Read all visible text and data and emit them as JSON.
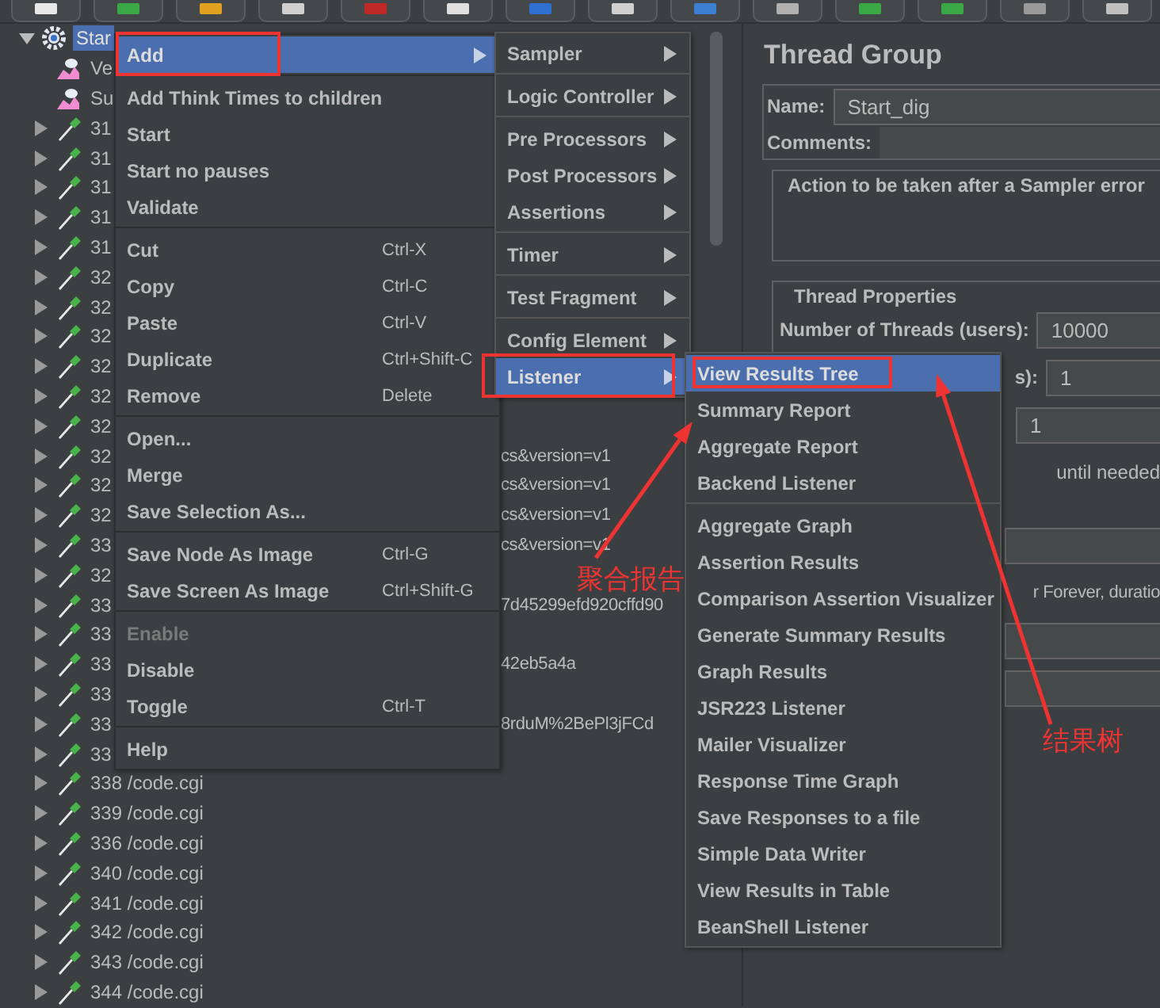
{
  "tree": {
    "items": [
      {
        "label": "Star",
        "kind": "thread_group",
        "expanded": true,
        "selected": true,
        "children": [
          {
            "label": "Ve",
            "kind": "listener",
            "selected": false
          },
          {
            "label": "Su",
            "kind": "listener",
            "selected": false
          },
          {
            "label": "31",
            "kind": "sampler",
            "expanded": false,
            "selected": false
          },
          {
            "label": "31",
            "kind": "sampler",
            "expanded": false,
            "selected": false
          },
          {
            "label": "31",
            "kind": "sampler",
            "expanded": false,
            "selected": false
          },
          {
            "label": "31",
            "kind": "sampler",
            "expanded": false,
            "selected": false
          },
          {
            "label": "31",
            "kind": "sampler",
            "expanded": false,
            "selected": false
          },
          {
            "label": "32",
            "kind": "sampler",
            "expanded": false,
            "selected": false
          },
          {
            "label": "32",
            "kind": "sampler",
            "expanded": false,
            "selected": false
          },
          {
            "label": "32",
            "kind": "sampler",
            "expanded": false,
            "selected": false
          },
          {
            "label": "32",
            "kind": "sampler",
            "expanded": false,
            "selected": false
          },
          {
            "label": "32",
            "kind": "sampler",
            "expanded": false,
            "selected": false
          },
          {
            "label": "32",
            "kind": "sampler",
            "expanded": false,
            "selected": false
          },
          {
            "label": "32",
            "tail": "cs&version=v1",
            "kind": "sampler",
            "expanded": false,
            "selected": false
          },
          {
            "label": "32",
            "tail": "cs&version=v1",
            "kind": "sampler",
            "expanded": false,
            "selected": false
          },
          {
            "label": "32",
            "tail": "cs&version=v1",
            "kind": "sampler",
            "expanded": false,
            "selected": false
          },
          {
            "label": "33",
            "tail": "cs&version=v1",
            "kind": "sampler",
            "expanded": false,
            "selected": false
          },
          {
            "label": "32",
            "kind": "sampler",
            "expanded": false,
            "selected": false
          },
          {
            "label": "33",
            "tail": "7d45299efd920cffd90",
            "kind": "sampler",
            "expanded": false,
            "selected": false
          },
          {
            "label": "33",
            "kind": "sampler",
            "expanded": false,
            "selected": false
          },
          {
            "label": "33",
            "tail": "42eb5a4a",
            "kind": "sampler",
            "expanded": false,
            "selected": false
          },
          {
            "label": "33",
            "kind": "sampler",
            "expanded": false,
            "selected": false
          },
          {
            "label": "33",
            "tail": "8rduM%2BePl3jFCd",
            "kind": "sampler",
            "expanded": false,
            "selected": false
          },
          {
            "label": "33",
            "kind": "sampler",
            "expanded": false,
            "selected": false
          },
          {
            "label": "338 /code.cgi",
            "kind": "sampler",
            "expanded": false,
            "selected": false
          },
          {
            "label": "339 /code.cgi",
            "kind": "sampler",
            "expanded": false,
            "selected": false
          },
          {
            "label": "336 /code.cgi",
            "kind": "sampler",
            "expanded": false,
            "selected": false
          },
          {
            "label": "340 /code.cgi",
            "kind": "sampler",
            "expanded": false,
            "selected": false
          },
          {
            "label": "341 /code.cgi",
            "kind": "sampler",
            "expanded": false,
            "selected": false
          },
          {
            "label": "342 /code.cgi",
            "kind": "sampler",
            "expanded": false,
            "selected": false
          },
          {
            "label": "343 /code.cgi",
            "kind": "sampler",
            "expanded": false,
            "selected": false
          },
          {
            "label": "344 /code.cgi",
            "kind": "sampler",
            "expanded": false,
            "selected": false
          }
        ]
      }
    ]
  },
  "form": {
    "title": "Thread Group",
    "name_label": "Name:",
    "name_value": "Start_dig",
    "comments_label": "Comments:",
    "error_group": "Action to be taken after a Sampler error",
    "thread_properties": {
      "legend": "Thread Properties",
      "rows": [
        {
          "kind": "field",
          "label": "Number of Threads (users):",
          "value": "10000"
        },
        {
          "kind": "field",
          "label": "s):",
          "value": "1"
        },
        {
          "kind": "field",
          "value": "1"
        },
        {
          "kind": "text",
          "label": "until needed"
        },
        {
          "kind": "field"
        },
        {
          "kind": "text",
          "label": "r Forever, duratio"
        },
        {
          "kind": "field"
        },
        {
          "kind": "field"
        }
      ]
    }
  },
  "context_menu": {
    "groups": [
      {
        "items": [
          {
            "label": "Add",
            "submenu": true,
            "selected": true,
            "disabled": false,
            "marked": true
          }
        ]
      },
      {
        "items": [
          {
            "label": "Add Think Times to children",
            "selected": false,
            "disabled": false,
            "marked": false
          },
          {
            "label": "Start",
            "selected": false,
            "disabled": false,
            "marked": false
          },
          {
            "label": "Start no pauses",
            "selected": false,
            "disabled": false,
            "marked": false
          },
          {
            "label": "Validate",
            "selected": false,
            "disabled": false,
            "marked": false
          }
        ]
      },
      {
        "items": [
          {
            "label": "Cut",
            "shortcut": "Ctrl-X",
            "selected": false,
            "disabled": false,
            "marked": false
          },
          {
            "label": "Copy",
            "shortcut": "Ctrl-C",
            "selected": false,
            "disabled": false,
            "marked": false
          },
          {
            "label": "Paste",
            "shortcut": "Ctrl-V",
            "selected": false,
            "disabled": false,
            "marked": false
          },
          {
            "label": "Duplicate",
            "shortcut": "Ctrl+Shift-C",
            "selected": false,
            "disabled": false,
            "marked": false
          },
          {
            "label": "Remove",
            "shortcut": "Delete",
            "selected": false,
            "disabled": false,
            "marked": false
          }
        ]
      },
      {
        "items": [
          {
            "label": "Open...",
            "selected": false,
            "disabled": false,
            "marked": false
          },
          {
            "label": "Merge",
            "selected": false,
            "disabled": false,
            "marked": false
          },
          {
            "label": "Save Selection As...",
            "selected": false,
            "disabled": false,
            "marked": false
          }
        ]
      },
      {
        "items": [
          {
            "label": "Save Node As Image",
            "shortcut": "Ctrl-G",
            "selected": false,
            "disabled": false,
            "marked": false
          },
          {
            "label": "Save Screen As Image",
            "shortcut": "Ctrl+Shift-G",
            "selected": false,
            "disabled": false,
            "marked": false
          }
        ]
      },
      {
        "items": [
          {
            "label": "Enable",
            "selected": false,
            "disabled": true,
            "marked": false
          },
          {
            "label": "Disable",
            "selected": false,
            "disabled": false,
            "marked": false
          },
          {
            "label": "Toggle",
            "shortcut": "Ctrl-T",
            "selected": false,
            "disabled": false,
            "marked": false
          }
        ]
      },
      {
        "items": [
          {
            "label": "Help",
            "selected": false,
            "disabled": false,
            "marked": false
          }
        ]
      }
    ]
  },
  "add_submenu": {
    "groups": [
      {
        "items": [
          {
            "label": "Sampler",
            "submenu": true,
            "selected": false,
            "marked": false
          }
        ]
      },
      {
        "items": [
          {
            "label": "Logic Controller",
            "submenu": true,
            "selected": false,
            "marked": false
          }
        ]
      },
      {
        "items": [
          {
            "label": "Pre Processors",
            "submenu": true,
            "selected": false,
            "marked": false
          },
          {
            "label": "Post Processors",
            "submenu": true,
            "selected": false,
            "marked": false
          },
          {
            "label": "Assertions",
            "submenu": true,
            "selected": false,
            "marked": false
          }
        ]
      },
      {
        "items": [
          {
            "label": "Timer",
            "submenu": true,
            "selected": false,
            "marked": false
          }
        ]
      },
      {
        "items": [
          {
            "label": "Test Fragment",
            "submenu": true,
            "selected": false,
            "marked": false
          }
        ]
      },
      {
        "items": [
          {
            "label": "Config Element",
            "submenu": true,
            "selected": false,
            "marked": false
          },
          {
            "label": "Listener",
            "submenu": true,
            "selected": true,
            "marked": true
          }
        ]
      }
    ]
  },
  "listener_submenu": {
    "groups": [
      {
        "items": [
          {
            "label": "View Results Tree",
            "selected": true,
            "marked": true
          },
          {
            "label": "Summary Report",
            "selected": false,
            "marked": false
          },
          {
            "label": "Aggregate Report",
            "selected": false,
            "marked": false
          },
          {
            "label": "Backend Listener",
            "selected": false,
            "marked": false
          }
        ]
      },
      {
        "items": [
          {
            "label": "Aggregate Graph",
            "selected": false,
            "marked": false
          },
          {
            "label": "Assertion Results",
            "selected": false,
            "marked": false
          },
          {
            "label": "Comparison Assertion Visualizer",
            "selected": false,
            "marked": false
          },
          {
            "label": "Generate Summary Results",
            "selected": false,
            "marked": false
          },
          {
            "label": "Graph Results",
            "selected": false,
            "marked": false
          },
          {
            "label": "JSR223 Listener",
            "selected": false,
            "marked": false
          },
          {
            "label": "Mailer Visualizer",
            "selected": false,
            "marked": false
          },
          {
            "label": "Response Time Graph",
            "selected": false,
            "marked": false
          },
          {
            "label": "Save Responses to a file",
            "selected": false,
            "marked": false
          },
          {
            "label": "Simple Data Writer",
            "selected": false,
            "marked": false
          },
          {
            "label": "View Results in Table",
            "selected": false,
            "marked": false
          },
          {
            "label": "BeanShell Listener",
            "selected": false,
            "marked": false
          }
        ]
      }
    ]
  },
  "annotations": [
    {
      "text": "聚合报告"
    },
    {
      "text": "结果树"
    }
  ]
}
